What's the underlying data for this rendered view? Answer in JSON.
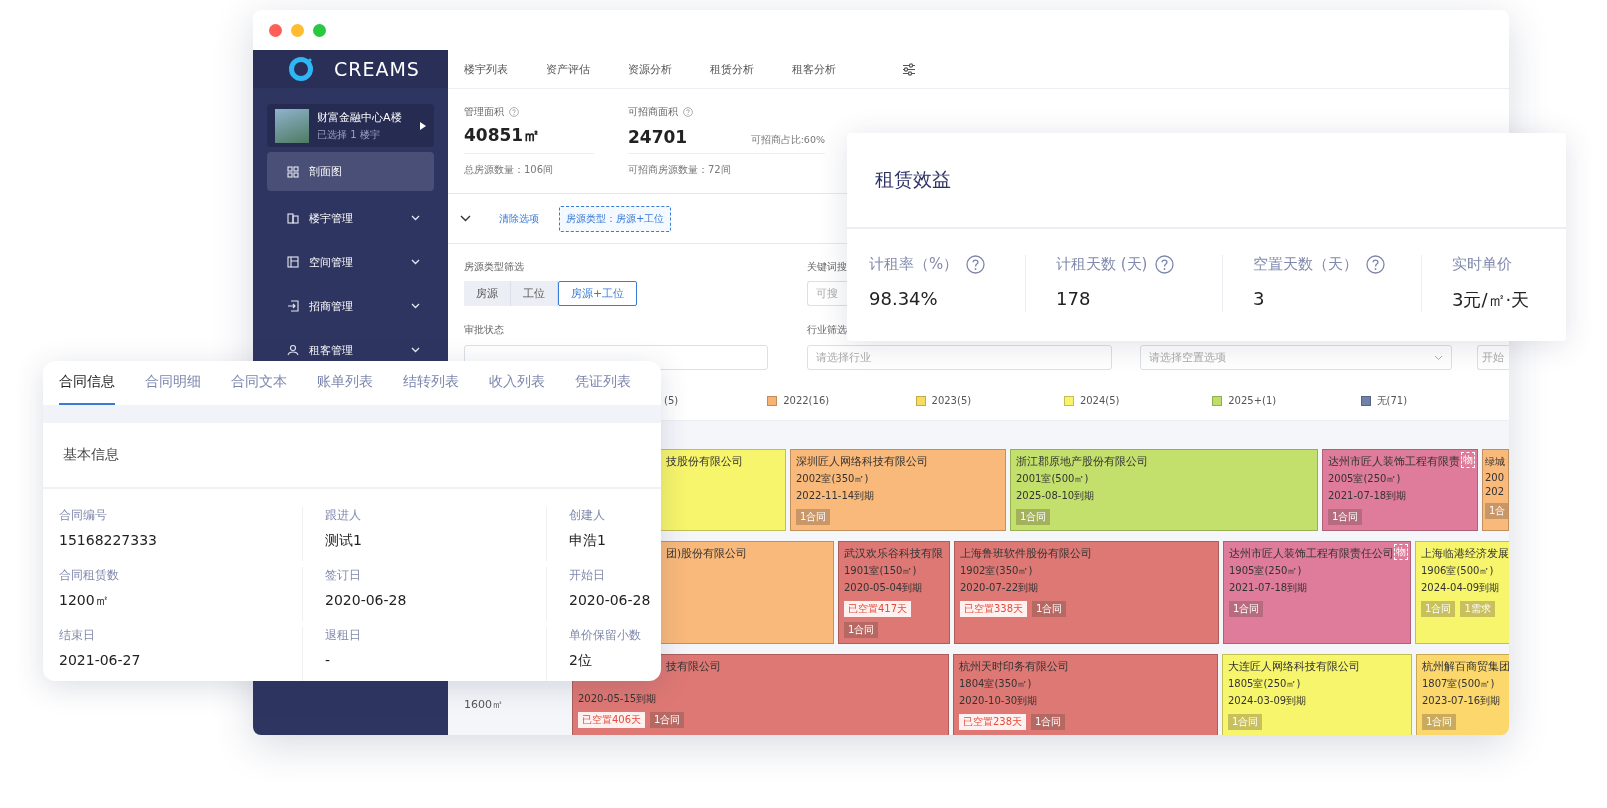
{
  "window_controls": [
    {
      "color": "#ff5f57"
    },
    {
      "color": "#febc2e"
    },
    {
      "color": "#28c840"
    }
  ],
  "sidebar": {
    "logo_text": "CREAMS",
    "building": {
      "name": "财富金融中心A楼",
      "subtitle": "已选择 1 楼宇"
    },
    "items": [
      {
        "label": "剖面图",
        "selected": true,
        "expandable": false
      },
      {
        "label": "楼宇管理",
        "selected": false,
        "expandable": true
      },
      {
        "label": "空间管理",
        "selected": false,
        "expandable": true
      },
      {
        "label": "招商管理",
        "selected": false,
        "expandable": true
      },
      {
        "label": "租客管理",
        "selected": false,
        "expandable": true
      }
    ]
  },
  "nav_tabs": [
    "楼宇列表",
    "资产评估",
    "资源分析",
    "租赁分析",
    "租客分析"
  ],
  "stats": [
    {
      "label": "管理面积",
      "value": "40851㎡",
      "sub": "总房源数量：106间"
    },
    {
      "label": "可招商面积",
      "value": "24701",
      "note": "可招商占比:60%",
      "sub": "可招商房源数量：72间"
    }
  ],
  "filter_bar": {
    "clear": "清除选项",
    "chip": "房源类型：房源+工位"
  },
  "filters": {
    "type_label": "房源类型筛选",
    "type_options": [
      {
        "label": "房源",
        "selected": false
      },
      {
        "label": "工位",
        "selected": false
      },
      {
        "label": "房源+工位",
        "selected": true
      }
    ],
    "keyword": {
      "label": "关键词搜",
      "placeholder": "可搜"
    },
    "approval": {
      "label": "审批状态"
    },
    "industry": {
      "label": "行业筛选",
      "placeholder": "请选择行业"
    },
    "vacancy": {
      "placeholder": "请选择空置选项"
    },
    "start": {
      "placeholder": "开始"
    }
  },
  "legend": [
    {
      "label": "(5)"
    },
    {
      "label": "2022(16)",
      "color": "#f8b273"
    },
    {
      "label": "2023(5)",
      "color": "#f7dc5f"
    },
    {
      "label": "2024(5)",
      "color": "#f9f36a"
    },
    {
      "label": "2025+(1)",
      "color": "#bddf6a"
    },
    {
      "label": "无(71)",
      "color": "#6f82a8"
    }
  ],
  "floor_rows": [
    {
      "units": [
        {
          "color": "#f7f56b",
          "name": "技股份有限公司"
        },
        {
          "color": "#f9b97a",
          "name": "深圳匠人网络科技有限公司",
          "room": "2002室(350㎡)",
          "due": "2022-11-14到期",
          "tags": [
            {
              "kind": "contract",
              "text": "1合同"
            }
          ]
        },
        {
          "color": "#c3e06c",
          "name": "浙江郡原地产股份有限公司",
          "room": "2001室(500㎡)",
          "due": "2025-08-10到期",
          "tags": [
            {
              "kind": "contract",
              "text": "1合同"
            }
          ]
        },
        {
          "color": "#df7b9b",
          "name": "达州市匠人装饰工程有限责",
          "badge": "物",
          "room": "2005室(250㎡)",
          "due": "2021-07-18到期",
          "tags": [
            {
              "kind": "contract",
              "text": "1合同"
            }
          ]
        },
        {
          "color": "#f9b97a",
          "name": "绿城",
          "room": "200",
          "due": "202",
          "tags": [
            {
              "kind": "contract",
              "text": "1合"
            }
          ]
        }
      ]
    },
    {
      "units": [
        {
          "color": "#f9b97a",
          "name": "团)股份有限公司"
        },
        {
          "color": "#de7874",
          "name": "武汉欢乐谷科技有限",
          "room": "1901室(150㎡)",
          "due": "2020-05-04到期",
          "tags": [
            {
              "kind": "vacant",
              "text": "已空置417天"
            },
            {
              "kind": "contract",
              "text": "1合同"
            }
          ]
        },
        {
          "color": "#de7874",
          "name": "上海鲁班软件股份有限公司",
          "room": "1902室(350㎡)",
          "due": "2020-07-22到期",
          "tags": [
            {
              "kind": "vacant",
              "text": "已空置338天"
            },
            {
              "kind": "contract",
              "text": "1合同"
            }
          ]
        },
        {
          "color": "#df7b9b",
          "name": "达州市匠人装饰工程有限责任公司",
          "badge": "物",
          "room": "1905室(250㎡)",
          "due": "2021-07-18到期",
          "tags": [
            {
              "kind": "contract",
              "text": "1合同"
            }
          ]
        },
        {
          "color": "#f7f56b",
          "name": "上海临港经济发展",
          "room": "1906室(500㎡)",
          "due": "2024-04-09到期",
          "tags": [
            {
              "kind": "contract",
              "text": "1合同"
            },
            {
              "kind": "demand",
              "text": "1需求"
            }
          ]
        }
      ]
    },
    {
      "label": "1600㎡",
      "units": [
        {
          "color": "#de7874",
          "name": "技有限公司",
          "due": "2020-05-15到期",
          "tags": [
            {
              "kind": "vacant",
              "text": "已空置406天"
            },
            {
              "kind": "contract",
              "text": "1合同"
            }
          ]
        },
        {
          "color": "#de7874",
          "name": "杭州天时印务有限公司",
          "room": "1804室(350㎡)",
          "due": "2020-10-30到期",
          "tags": [
            {
              "kind": "vacant",
              "text": "已空置238天"
            },
            {
              "kind": "contract",
              "text": "1合同"
            }
          ]
        },
        {
          "color": "#f7f56b",
          "name": "大连匠人网络科技有限公司",
          "room": "1805室(250㎡)",
          "due": "2024-03-09到期",
          "tags": [
            {
              "kind": "contract",
              "text": "1合同"
            }
          ]
        },
        {
          "color": "#fbd76c",
          "name": "杭州解百商贸集团",
          "room": "1807室(500㎡)",
          "due": "2023-07-16到期",
          "tags": [
            {
              "kind": "contract",
              "text": "1合同"
            }
          ]
        }
      ]
    }
  ],
  "rental_card": {
    "title": "租赁效益",
    "metrics": [
      {
        "label": "计租率（%）",
        "value": "98.34%",
        "help": true
      },
      {
        "label": "计租天数 (天)",
        "value": "178",
        "help": true
      },
      {
        "label": "空置天数（天）",
        "value": "3",
        "help": true
      },
      {
        "label": "实时单价",
        "value": "3元/㎡·天",
        "help": false
      }
    ]
  },
  "contract_card": {
    "tabs": [
      {
        "label": "合同信息",
        "selected": true
      },
      {
        "label": "合同明细",
        "selected": false
      },
      {
        "label": "合同文本",
        "selected": false
      },
      {
        "label": "账单列表",
        "selected": false
      },
      {
        "label": "结转列表",
        "selected": false
      },
      {
        "label": "收入列表",
        "selected": false
      },
      {
        "label": "凭证列表",
        "selected": false
      }
    ],
    "section_title": "基本信息",
    "fields": [
      {
        "label": "合同编号",
        "value": "15168227333"
      },
      {
        "label": "跟进人",
        "value": "测试1"
      },
      {
        "label": "创建人",
        "value": "申浩1"
      },
      {
        "label": "合同租赁数",
        "value": "1200㎡"
      },
      {
        "label": "签订日",
        "value": "2020-06-28"
      },
      {
        "label": "开始日",
        "value": "2020-06-28"
      },
      {
        "label": "结束日",
        "value": "2021-06-27"
      },
      {
        "label": "退租日",
        "value": "-"
      },
      {
        "label": "单价保留小数",
        "value": "2位"
      }
    ]
  }
}
